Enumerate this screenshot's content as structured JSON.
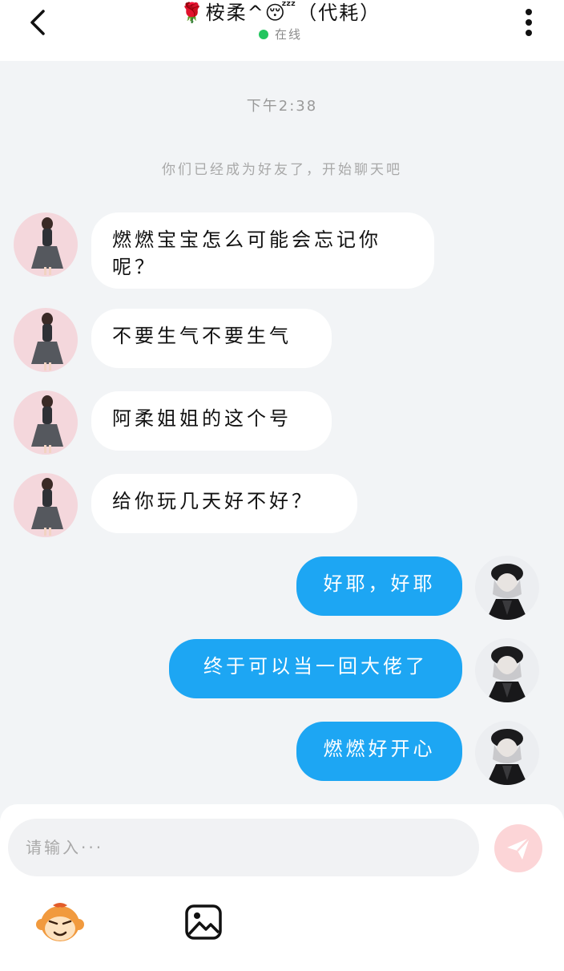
{
  "header": {
    "title": "🌹桉柔^😴（代耗）",
    "status": "在线",
    "status_color": "#22c55e"
  },
  "chat": {
    "timestamp": "下午2:38",
    "system_notice": "你们已经成为好友了，开始聊天吧",
    "messages": [
      {
        "side": "incoming",
        "text": "燃燃宝宝怎么可能会忘记你呢？"
      },
      {
        "side": "incoming",
        "text": "不要生气不要生气"
      },
      {
        "side": "incoming",
        "text": "阿柔姐姐的这个号"
      },
      {
        "side": "incoming",
        "text": "给你玩几天好不好？"
      },
      {
        "side": "outgoing",
        "text": "好耶，好耶"
      },
      {
        "side": "outgoing",
        "text": "终于可以当一回大佬了"
      },
      {
        "side": "outgoing",
        "text": "燃燃好开心"
      }
    ]
  },
  "composer": {
    "placeholder": "请输入···",
    "value": "",
    "send_icon": "paper-plane-icon",
    "tools": [
      "emoji-monkey-icon",
      "image-icon"
    ]
  },
  "colors": {
    "outgoing_bubble": "#1da6f3",
    "incoming_bubble": "#ffffff",
    "background": "#f2f4f6",
    "send_button": "#fcd5d7"
  }
}
